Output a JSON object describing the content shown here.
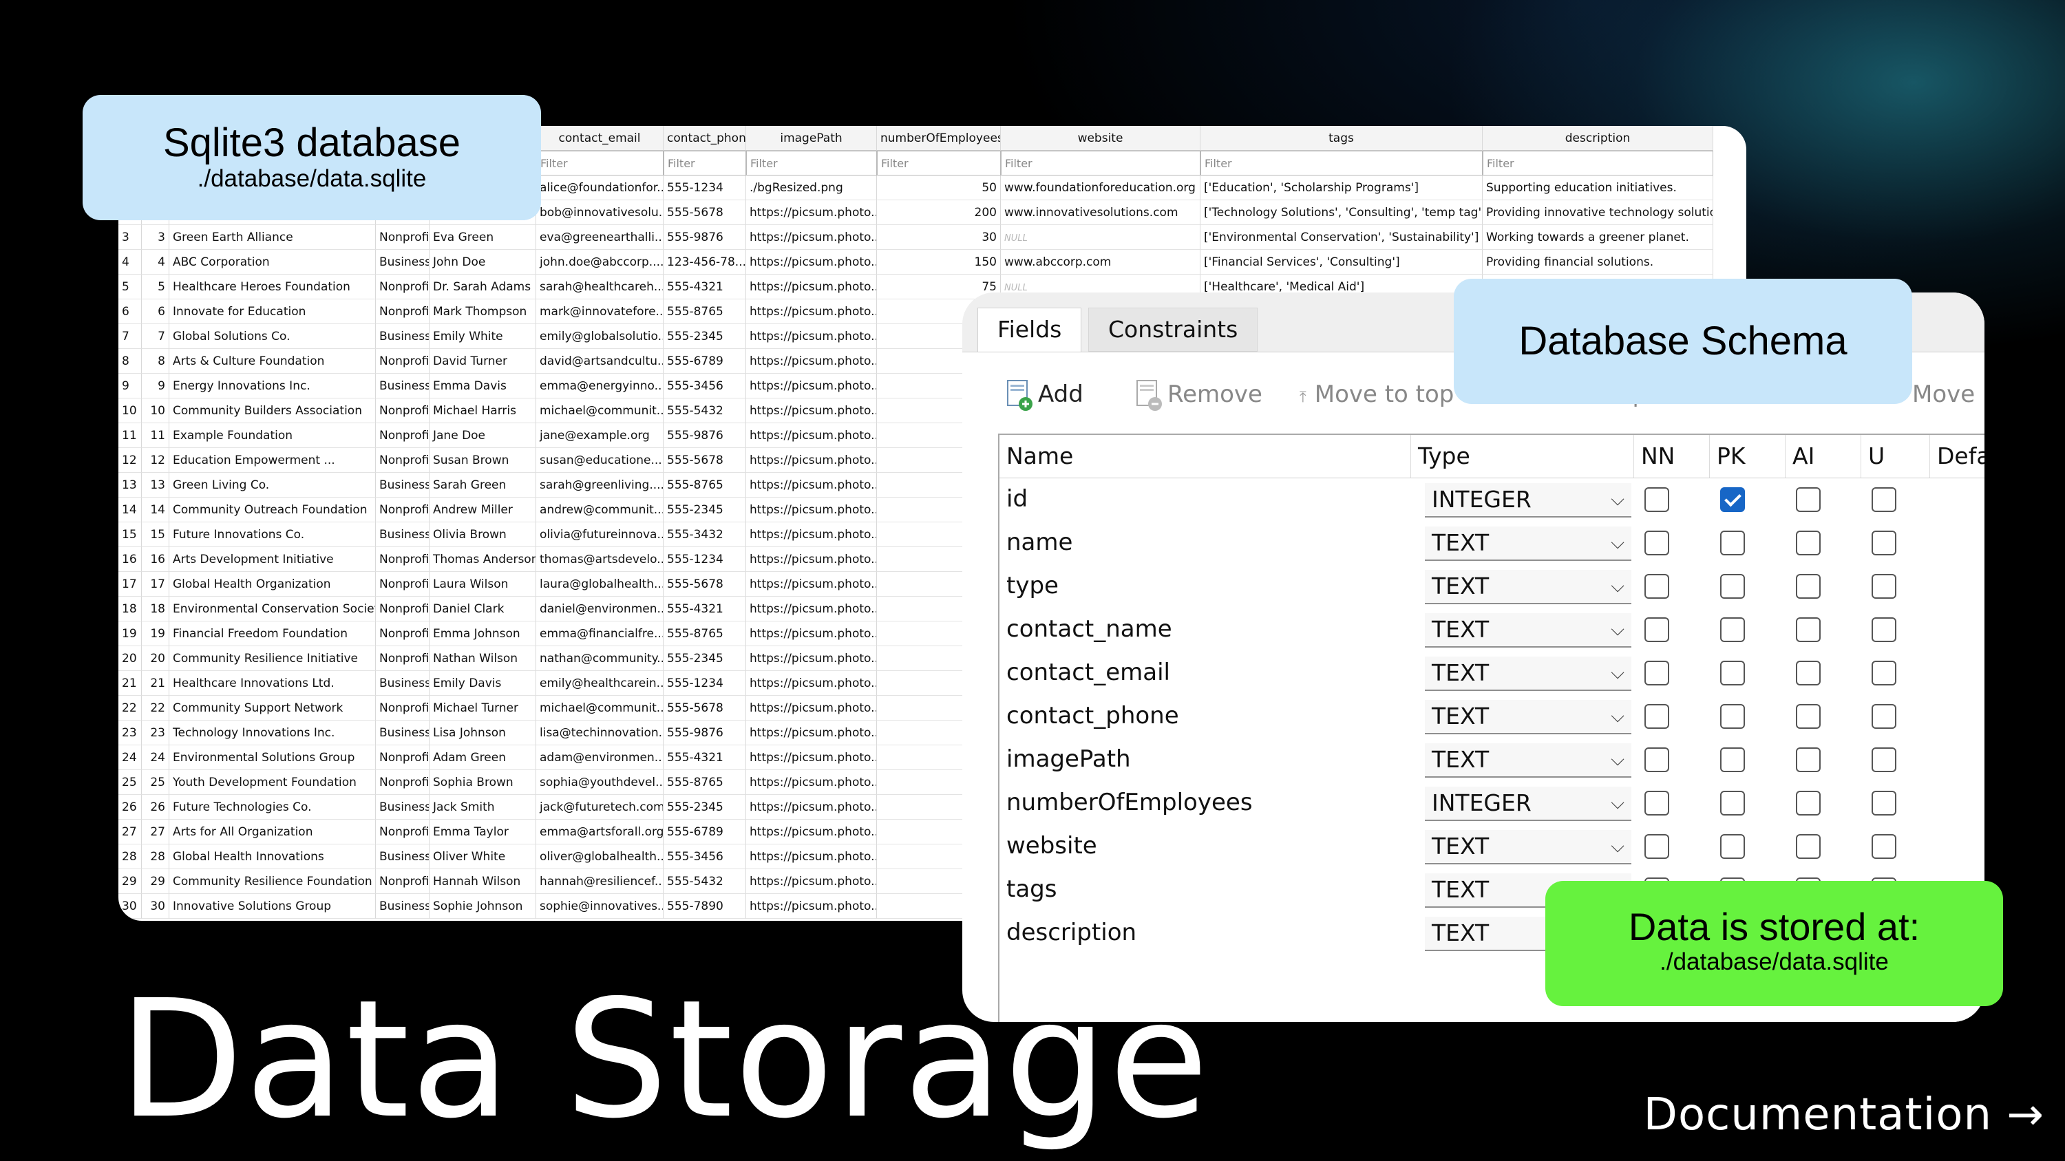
{
  "data_table": {
    "columns": [
      "",
      "",
      "",
      "",
      "",
      "contact_email",
      "contact_phone",
      "imagePath",
      "numberOfEmployees",
      "website",
      "tags",
      "description"
    ],
    "filter_placeholder": "Filter",
    "partial_rows": [
      {
        "contact_email": "alice@foundationfor...",
        "contact_phone": "555-1234",
        "imagePath": "./bgResized.png",
        "numberOfEmployees": "50",
        "website": "www.foundationforeducation.org",
        "tags": "['Education', 'Scholarship Programs']",
        "description": "Supporting education initiatives."
      },
      {
        "contact_email": "bob@innovativesolu...",
        "contact_phone": "555-5678",
        "imagePath": "https://picsum.photo...",
        "numberOfEmployees": "200",
        "website": "www.innovativesolutions.com",
        "tags": "['Technology Solutions', 'Consulting', 'temp tag']",
        "description": "Providing innovative technology solutions."
      }
    ],
    "rows": [
      {
        "rownum": "3",
        "id": "3",
        "name": "Green Earth Alliance",
        "type": "Nonprofit",
        "contact_name": "Eva Green",
        "contact_email": "eva@greenearthalli...",
        "contact_phone": "555-9876",
        "imagePath": "https://picsum.photo...",
        "numberOfEmployees": "30",
        "website": "NULL",
        "tags": "['Environmental Conservation', 'Sustainability']",
        "description": "Working towards a greener planet."
      },
      {
        "rownum": "4",
        "id": "4",
        "name": "ABC Corporation",
        "type": "Business",
        "contact_name": "John Doe",
        "contact_email": "john.doe@abccorp....",
        "contact_phone": "123-456-78...",
        "imagePath": "https://picsum.photo...",
        "numberOfEmployees": "150",
        "website": "www.abccorp.com",
        "tags": "['Financial Services', 'Consulting']",
        "description": "Providing financial solutions."
      },
      {
        "rownum": "5",
        "id": "5",
        "name": "Healthcare Heroes Foundation",
        "type": "Nonprofit",
        "contact_name": "Dr. Sarah Adams",
        "contact_email": "sarah@healthcareh...",
        "contact_phone": "555-4321",
        "imagePath": "https://picsum.photo...",
        "numberOfEmployees": "75",
        "website": "NULL",
        "tags": "['Healthcare', 'Medical Aid']",
        "description": ""
      },
      {
        "rownum": "6",
        "id": "6",
        "name": "Innovate for Education",
        "type": "Nonprofit",
        "contact_name": "Mark Thompson",
        "contact_email": "mark@innovatefore...",
        "contact_phone": "555-8765",
        "imagePath": "https://picsum.photo..."
      },
      {
        "rownum": "7",
        "id": "7",
        "name": "Global Solutions Co.",
        "type": "Business",
        "contact_name": "Emily White",
        "contact_email": "emily@globalsolutio...",
        "contact_phone": "555-2345",
        "imagePath": "https://picsum.photo..."
      },
      {
        "rownum": "8",
        "id": "8",
        "name": "Arts & Culture Foundation",
        "type": "Nonprofit",
        "contact_name": "David Turner",
        "contact_email": "david@artsandcultu...",
        "contact_phone": "555-6789",
        "imagePath": "https://picsum.photo..."
      },
      {
        "rownum": "9",
        "id": "9",
        "name": "Energy Innovations Inc.",
        "type": "Business",
        "contact_name": "Emma Davis",
        "contact_email": "emma@energyinno...",
        "contact_phone": "555-3456",
        "imagePath": "https://picsum.photo..."
      },
      {
        "rownum": "10",
        "id": "10",
        "name": "Community Builders Association",
        "type": "Nonprofit",
        "contact_name": "Michael Harris",
        "contact_email": "michael@communit...",
        "contact_phone": "555-5432",
        "imagePath": "https://picsum.photo..."
      },
      {
        "rownum": "11",
        "id": "11",
        "name": "Example Foundation",
        "type": "Nonprofit",
        "contact_name": "Jane Doe",
        "contact_email": "jane@example.org",
        "contact_phone": "555-9876",
        "imagePath": "https://picsum.photo..."
      },
      {
        "rownum": "12",
        "id": "12",
        "name": "Education Empowerment ...",
        "type": "Nonprofit",
        "contact_name": "Susan Brown",
        "contact_email": "susan@educatione...",
        "contact_phone": "555-5678",
        "imagePath": "https://picsum.photo..."
      },
      {
        "rownum": "13",
        "id": "13",
        "name": "Green Living Co.",
        "type": "Business",
        "contact_name": "Sarah Green",
        "contact_email": "sarah@greenliving....",
        "contact_phone": "555-8765",
        "imagePath": "https://picsum.photo..."
      },
      {
        "rownum": "14",
        "id": "14",
        "name": "Community Outreach Foundation",
        "type": "Nonprofit",
        "contact_name": "Andrew Miller",
        "contact_email": "andrew@communit...",
        "contact_phone": "555-2345",
        "imagePath": "https://picsum.photo..."
      },
      {
        "rownum": "15",
        "id": "15",
        "name": "Future Innovations Co.",
        "type": "Business",
        "contact_name": "Olivia Brown",
        "contact_email": "olivia@futureinnova...",
        "contact_phone": "555-3432",
        "imagePath": "https://picsum.photo..."
      },
      {
        "rownum": "16",
        "id": "16",
        "name": "Arts Development Initiative",
        "type": "Nonprofit",
        "contact_name": "Thomas Anderson",
        "contact_email": "thomas@artsdevelo...",
        "contact_phone": "555-1234",
        "imagePath": "https://picsum.photo..."
      },
      {
        "rownum": "17",
        "id": "17",
        "name": "Global Health Organization",
        "type": "Nonprofit",
        "contact_name": "Laura Wilson",
        "contact_email": "laura@globalhealth....",
        "contact_phone": "555-5678",
        "imagePath": "https://picsum.photo..."
      },
      {
        "rownum": "18",
        "id": "18",
        "name": "Environmental Conservation Society",
        "type": "Nonprofit",
        "contact_name": "Daniel Clark",
        "contact_email": "daniel@environmen...",
        "contact_phone": "555-4321",
        "imagePath": "https://picsum.photo..."
      },
      {
        "rownum": "19",
        "id": "19",
        "name": "Financial Freedom Foundation",
        "type": "Nonprofit",
        "contact_name": "Emma Johnson",
        "contact_email": "emma@financialfre...",
        "contact_phone": "555-8765",
        "imagePath": "https://picsum.photo..."
      },
      {
        "rownum": "20",
        "id": "20",
        "name": "Community Resilience Initiative",
        "type": "Nonprofit",
        "contact_name": "Nathan Wilson",
        "contact_email": "nathan@community....",
        "contact_phone": "555-2345",
        "imagePath": "https://picsum.photo..."
      },
      {
        "rownum": "21",
        "id": "21",
        "name": "Healthcare Innovations Ltd.",
        "type": "Business",
        "contact_name": "Emily Davis",
        "contact_email": "emily@healthcarein...",
        "contact_phone": "555-1234",
        "imagePath": "https://picsum.photo..."
      },
      {
        "rownum": "22",
        "id": "22",
        "name": "Community Support Network",
        "type": "Nonprofit",
        "contact_name": "Michael Turner",
        "contact_email": "michael@communit...",
        "contact_phone": "555-5678",
        "imagePath": "https://picsum.photo..."
      },
      {
        "rownum": "23",
        "id": "23",
        "name": "Technology Innovations Inc.",
        "type": "Business",
        "contact_name": "Lisa Johnson",
        "contact_email": "lisa@techinnovation...",
        "contact_phone": "555-9876",
        "imagePath": "https://picsum.photo..."
      },
      {
        "rownum": "24",
        "id": "24",
        "name": "Environmental Solutions Group",
        "type": "Nonprofit",
        "contact_name": "Adam Green",
        "contact_email": "adam@environmen...",
        "contact_phone": "555-4321",
        "imagePath": "https://picsum.photo..."
      },
      {
        "rownum": "25",
        "id": "25",
        "name": "Youth Development Foundation",
        "type": "Nonprofit",
        "contact_name": "Sophia Brown",
        "contact_email": "sophia@youthdevel...",
        "contact_phone": "555-8765",
        "imagePath": "https://picsum.photo..."
      },
      {
        "rownum": "26",
        "id": "26",
        "name": "Future Technologies Co.",
        "type": "Business",
        "contact_name": "Jack Smith",
        "contact_email": "jack@futuretech.com",
        "contact_phone": "555-2345",
        "imagePath": "https://picsum.photo..."
      },
      {
        "rownum": "27",
        "id": "27",
        "name": "Arts for All Organization",
        "type": "Nonprofit",
        "contact_name": "Emma Taylor",
        "contact_email": "emma@artsforall.org",
        "contact_phone": "555-6789",
        "imagePath": "https://picsum.photo..."
      },
      {
        "rownum": "28",
        "id": "28",
        "name": "Global Health Innovations",
        "type": "Business",
        "contact_name": "Oliver White",
        "contact_email": "oliver@globalhealth...",
        "contact_phone": "555-3456",
        "imagePath": "https://picsum.photo..."
      },
      {
        "rownum": "29",
        "id": "29",
        "name": "Community Resilience Foundation",
        "type": "Nonprofit",
        "contact_name": "Hannah Wilson",
        "contact_email": "hannah@resiliencef...",
        "contact_phone": "555-5432",
        "imagePath": "https://picsum.photo..."
      },
      {
        "rownum": "30",
        "id": "30",
        "name": "Innovative Solutions Group",
        "type": "Business",
        "contact_name": "Sophie Johnson",
        "contact_email": "sophie@innovatives...",
        "contact_phone": "555-7890",
        "imagePath": "https://picsum.photo..."
      }
    ]
  },
  "schema": {
    "tabs": [
      "Fields",
      "Constraints"
    ],
    "toolbar": [
      "Add",
      "Remove",
      "Move to top",
      "Move up",
      "Move down",
      "Move"
    ],
    "headers": [
      "Name",
      "Type",
      "NN",
      "PK",
      "AI",
      "U",
      "Defa"
    ],
    "fields": [
      {
        "name": "id",
        "type": "INTEGER",
        "nn": false,
        "pk": true,
        "ai": false,
        "u": false
      },
      {
        "name": "name",
        "type": "TEXT",
        "nn": false,
        "pk": false,
        "ai": false,
        "u": false
      },
      {
        "name": "type",
        "type": "TEXT",
        "nn": false,
        "pk": false,
        "ai": false,
        "u": false
      },
      {
        "name": "contact_name",
        "type": "TEXT",
        "nn": false,
        "pk": false,
        "ai": false,
        "u": false
      },
      {
        "name": "contact_email",
        "type": "TEXT",
        "nn": false,
        "pk": false,
        "ai": false,
        "u": false
      },
      {
        "name": "contact_phone",
        "type": "TEXT",
        "nn": false,
        "pk": false,
        "ai": false,
        "u": false
      },
      {
        "name": "imagePath",
        "type": "TEXT",
        "nn": false,
        "pk": false,
        "ai": false,
        "u": false
      },
      {
        "name": "numberOfEmployees",
        "type": "INTEGER",
        "nn": false,
        "pk": false,
        "ai": false,
        "u": false
      },
      {
        "name": "website",
        "type": "TEXT",
        "nn": false,
        "pk": false,
        "ai": false,
        "u": false
      },
      {
        "name": "tags",
        "type": "TEXT",
        "nn": false,
        "pk": false,
        "ai": false,
        "u": false
      },
      {
        "name": "description",
        "type": "TEXT",
        "nn": false,
        "pk": false,
        "ai": false,
        "u": false
      }
    ]
  },
  "callouts": {
    "sqlite_title": "Sqlite3 database",
    "sqlite_path": "./database/data.sqlite",
    "schema_title": "Database Schema",
    "stored_title": "Data is stored at:",
    "stored_path": "./database/data.sqlite"
  },
  "page": {
    "title": "Data Storage",
    "doc_link": "Documentation →"
  },
  "colors": {
    "background": "#000000",
    "callout_blue": "#c8e6fa",
    "callout_green": "#66f23e",
    "checkbox_checked": "#1766c6"
  }
}
